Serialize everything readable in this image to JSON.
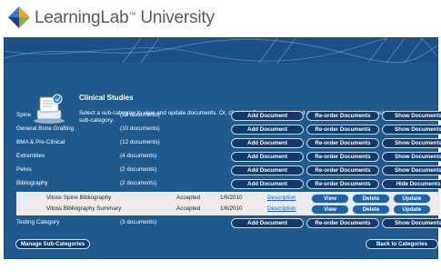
{
  "brand": {
    "name": "LearningLab",
    "tm": "™",
    "suffix": " University"
  },
  "section": {
    "title": "Clinical Studies",
    "description": "Select a sub-category to view and update documents.  Or, click Add Document to upload a new document or the associated sub-category."
  },
  "categories": [
    {
      "name": "Spine",
      "count": "(23 documents)",
      "add": "Add Document",
      "reorder": "Re-order Documents",
      "toggle": "Show Documents"
    },
    {
      "name": "General Bone Grafting",
      "count": "(10 documents)",
      "add": "Add Document",
      "reorder": "Re-order Documents",
      "toggle": "Show Documents"
    },
    {
      "name": "BMA & Pre-Clinical",
      "count": "(12 documents)",
      "add": "Add Document",
      "reorder": "Re-order Documents",
      "toggle": "Show Documents"
    },
    {
      "name": "Extremities",
      "count": "(4 documents)",
      "add": "Add Document",
      "reorder": "Re-order Documents",
      "toggle": "Show Documents"
    },
    {
      "name": "Pelvis",
      "count": "(2 documents)",
      "add": "Add Document",
      "reorder": "Re-order Documents",
      "toggle": "Show Documents"
    },
    {
      "name": "Bibliography",
      "count": "(2 documents)",
      "add": "Add Document",
      "reorder": "Re-order Documents",
      "toggle": "Hide Documents"
    },
    {
      "name": "Testing Category",
      "count": "(3 documents)",
      "add": "Add Document",
      "reorder": "Re-order Documents",
      "toggle": "Show Documents"
    }
  ],
  "documents": [
    {
      "name": "Vitoss Spine Bibliography",
      "status": "Accepted",
      "date": "1/6/2010",
      "link": "Description",
      "view": "View",
      "delete": "Delete",
      "update": "Update"
    },
    {
      "name": "Vitoss Bibliography Summary",
      "status": "Accepted",
      "date": "1/6/2010",
      "link": "Description",
      "view": "View",
      "delete": "Delete",
      "update": "Update"
    }
  ],
  "footer": {
    "manage": "Manage Sub-Categories",
    "back": "Back to Categories"
  },
  "colors": {
    "panel": "#1f5a8f",
    "button": "#0f3a6a",
    "subrow": "#ececec",
    "link": "#1a5fd1"
  },
  "icons": {
    "logo": "learninglab-logo-icon",
    "section": "book-icon"
  }
}
